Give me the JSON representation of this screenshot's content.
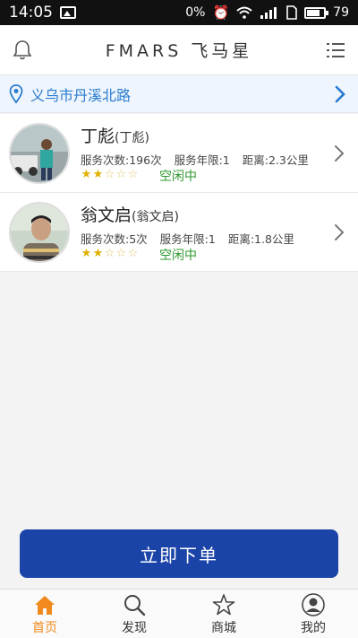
{
  "status_bar": {
    "time": "14:05",
    "battery_percent_text": "0%",
    "battery_level_text": "79"
  },
  "header": {
    "title": "FMARS 飞马星"
  },
  "location": {
    "label": "义乌市丹溪北路"
  },
  "workers": [
    {
      "name": "丁彪",
      "alias": "(丁彪)",
      "stats": [
        "服务次数:196次",
        "服务年限:1",
        "距离:2.3公里"
      ],
      "rating": 2,
      "rating_max": 5,
      "status": "空闲中"
    },
    {
      "name": "翁文启",
      "alias": "(翁文启)",
      "stats": [
        "服务次数:5次",
        "服务年限:1",
        "距离:1.8公里"
      ],
      "rating": 2,
      "rating_max": 5,
      "status": "空闲中"
    }
  ],
  "order_button": {
    "label": "立即下单"
  },
  "nav": {
    "items": [
      {
        "label": "首页",
        "icon": "home-icon",
        "active": true
      },
      {
        "label": "发现",
        "icon": "search-icon",
        "active": false
      },
      {
        "label": "商城",
        "icon": "star-icon",
        "active": false
      },
      {
        "label": "我的",
        "icon": "user-icon",
        "active": false
      }
    ]
  },
  "colors": {
    "accent_blue": "#1a44a8",
    "link_blue": "#2a7bd0",
    "status_green": "#2e9a2e",
    "nav_active": "#f08a1c",
    "star_gold": "#e0b000"
  }
}
